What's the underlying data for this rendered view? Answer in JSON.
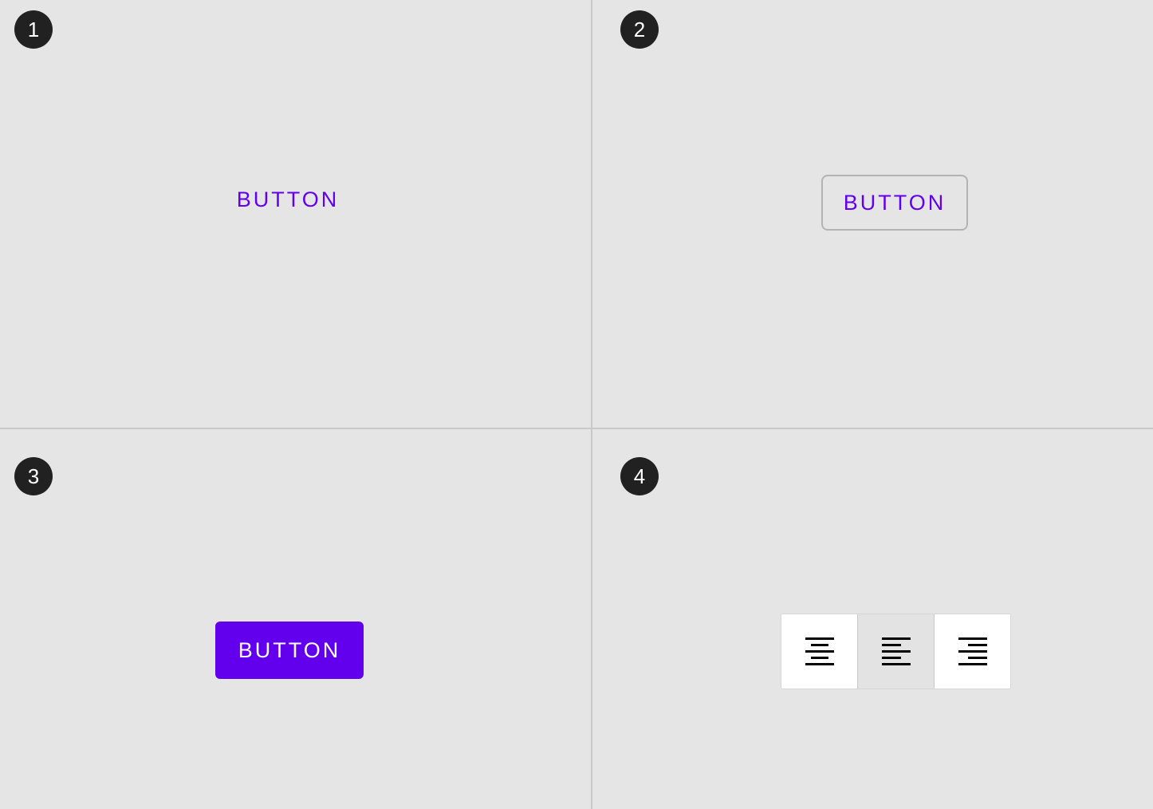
{
  "panels": [
    {
      "badge": "1",
      "button_label": "BUTTON",
      "variant": "text"
    },
    {
      "badge": "2",
      "button_label": "BUTTON",
      "variant": "outlined"
    },
    {
      "badge": "3",
      "button_label": "BUTTON",
      "variant": "contained"
    },
    {
      "badge": "4",
      "variant": "toggle-group",
      "toggles": [
        {
          "icon": "align-center-icon",
          "selected": false
        },
        {
          "icon": "align-left-icon",
          "selected": true
        },
        {
          "icon": "align-right-icon",
          "selected": false
        }
      ]
    }
  ],
  "colors": {
    "primary": "#6200ee",
    "background": "#e5e5e5",
    "badge": "#212121",
    "outline": "#b3b3b3",
    "selected_toggle": "#e3e3e3"
  }
}
